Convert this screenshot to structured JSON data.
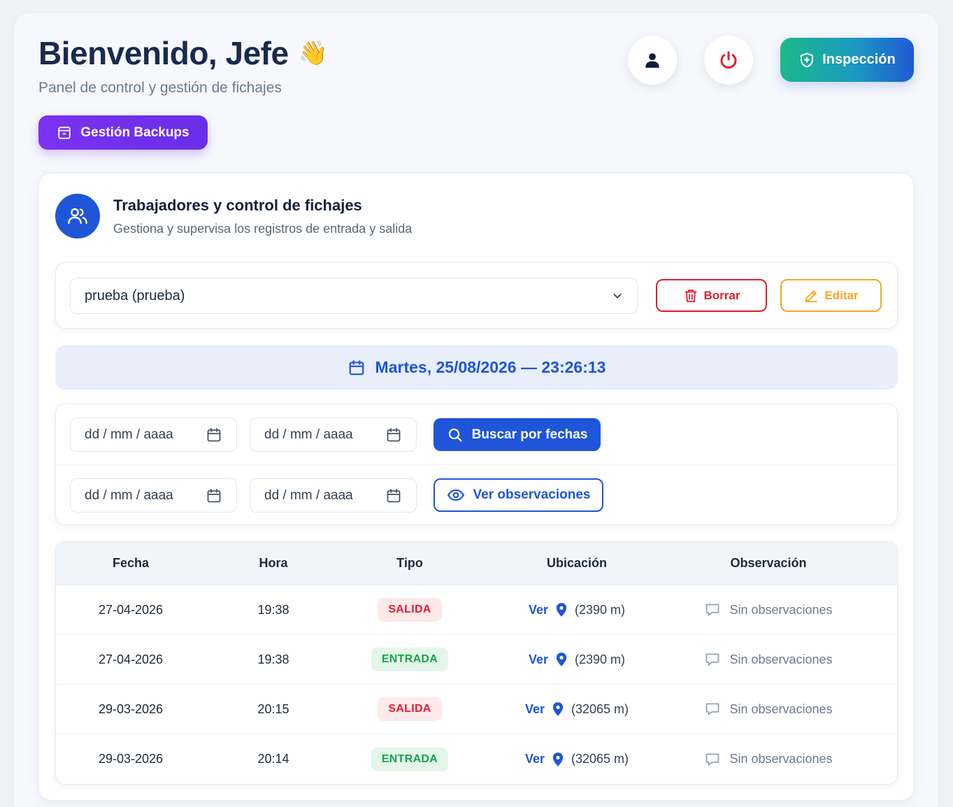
{
  "header": {
    "title": "Bienvenido, Jefe",
    "wave_emoji": "👋",
    "subtitle": "Panel de control y gestión de fichajes",
    "inspect_label": "Inspección",
    "backup_label": "Gestión Backups"
  },
  "workers": {
    "title": "Trabajadores y control de fichajes",
    "subtitle": "Gestiona y supervisa los registros de entrada y salida",
    "selected_worker": "prueba (prueba)",
    "delete_label": "Borrar",
    "edit_label": "Editar"
  },
  "datetime": "Martes, 25/08/2026 — 23:26:13",
  "filters": {
    "date_placeholder": "dd / mm / aaaa",
    "search_label": "Buscar por fechas",
    "observations_label": "Ver observaciones"
  },
  "table": {
    "headers": [
      "Fecha",
      "Hora",
      "Tipo",
      "Ubicación",
      "Observación"
    ],
    "rows": [
      {
        "fecha": "27-04-2026",
        "hora": "19:38",
        "tipo": "SALIDA",
        "ver": "Ver",
        "distancia": "(2390 m)",
        "obs": "Sin observaciones"
      },
      {
        "fecha": "27-04-2026",
        "hora": "19:38",
        "tipo": "ENTRADA",
        "ver": "Ver",
        "distancia": "(2390 m)",
        "obs": "Sin observaciones"
      },
      {
        "fecha": "29-03-2026",
        "hora": "20:15",
        "tipo": "SALIDA",
        "ver": "Ver",
        "distancia": "(32065 m)",
        "obs": "Sin observaciones"
      },
      {
        "fecha": "29-03-2026",
        "hora": "20:14",
        "tipo": "ENTRADA",
        "ver": "Ver",
        "distancia": "(32065 m)",
        "obs": "Sin observaciones"
      }
    ]
  },
  "colors": {
    "primary": "#1f55d8",
    "purple": "#7b31f2",
    "danger": "#e11d2e",
    "warning": "#f5a524",
    "success": "#16a34a"
  }
}
